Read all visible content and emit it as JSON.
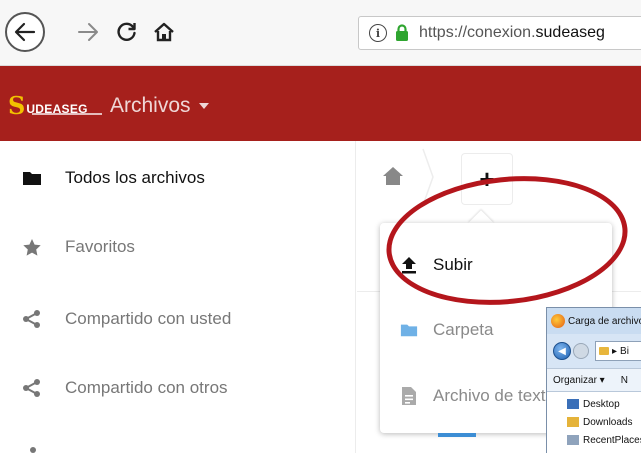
{
  "browser": {
    "url_prefix": "https://conexion.",
    "url_host": "sudeaseg"
  },
  "app": {
    "logo_initial": "S",
    "logo_text": "UDEASEG",
    "title": "Archivos"
  },
  "sidebar": {
    "items": [
      {
        "label": "Todos los archivos",
        "icon": "folder-icon"
      },
      {
        "label": "Favoritos",
        "icon": "star-icon"
      },
      {
        "label": "Compartido con usted",
        "icon": "share-icon"
      },
      {
        "label": "Compartido con otros",
        "icon": "share-icon"
      }
    ]
  },
  "new_menu": {
    "button_label": "+",
    "items": [
      {
        "label": "Subir",
        "icon": "upload-icon"
      },
      {
        "label": "Carpeta",
        "icon": "folder-icon"
      },
      {
        "label": "Archivo de texto",
        "icon": "text-file-icon"
      }
    ]
  },
  "file_dialog": {
    "title": "Carga de archivos",
    "path": "Bi",
    "toolbar_label": "Organizar ▾",
    "toolbar_next": "N",
    "tree": [
      "Desktop",
      "Downloads",
      "RecentPlaces"
    ]
  },
  "colors": {
    "header": "#a6201c",
    "logo_accent": "#f2c200",
    "annotation": "#b4161c",
    "accent_blue": "#3c8dd4"
  }
}
